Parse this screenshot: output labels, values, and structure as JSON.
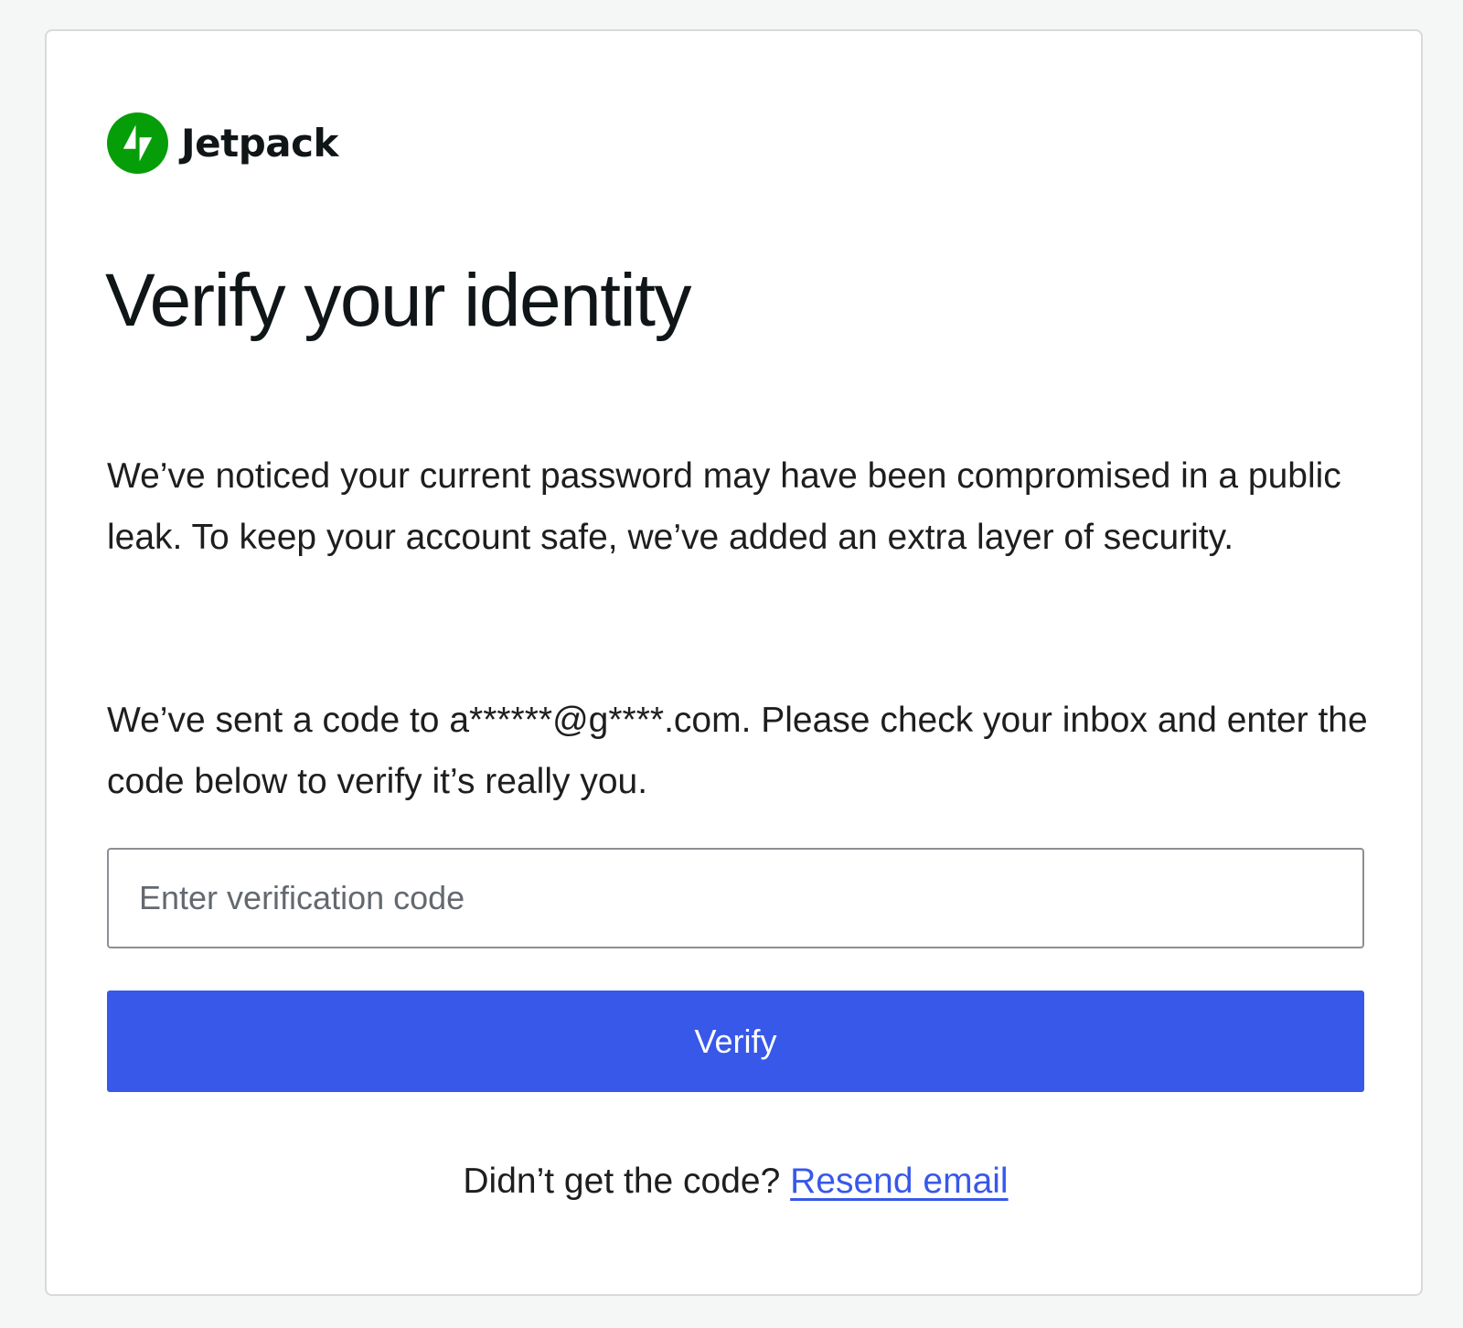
{
  "brand": {
    "name": "Jetpack",
    "logo_icon": "jetpack-bolt-icon",
    "logo_color": "#069e08"
  },
  "page": {
    "title": "Verify your identity",
    "paragraph_1": "We’ve noticed your current password may have been compromised in a public leak. To keep your account safe, we’ve added an extra layer of security.",
    "paragraph_2": "We’ve sent a code to a******@g****.com. Please check your inbox and enter the code below to verify it’s really you."
  },
  "form": {
    "code_placeholder": "Enter verification code",
    "code_value": "",
    "verify_label": "Verify",
    "verify_color": "#3858e9"
  },
  "footer": {
    "prompt": "Didn’t get the code?",
    "resend_label": "Resend email"
  }
}
